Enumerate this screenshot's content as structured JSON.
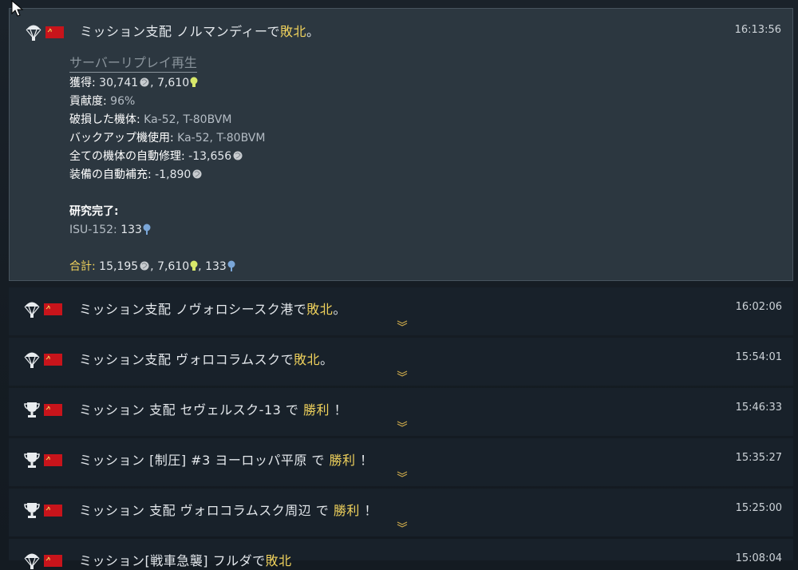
{
  "entries": [
    {
      "title_prefix": "ミッション支配 ノルマンディーで",
      "result": "敗北",
      "title_suffix": "。",
      "time": "16:13:56",
      "icon": "parachute-icon",
      "details": {
        "replay_label": "サーバーリプレイ再生",
        "earned_label": "獲得:",
        "earned_sl": "30,741",
        "earned_rp": "7,610",
        "activity_label": "貢献度:",
        "activity_value": "96%",
        "damaged_label": "破損した機体:",
        "damaged_value": "Ka-52, T-80BVM",
        "backup_label": "バックアップ機使用:",
        "backup_value": "Ka-52, T-80BVM",
        "repair_label": "全ての機体の自動修理:",
        "repair_value": "-13,656",
        "ammo_label": "装備の自動補充:",
        "ammo_value": "-1,890",
        "research_label": "研究完了:",
        "research_unit": "ISU-152:",
        "research_value": "133",
        "total_label": "合計:",
        "total_sl": "15,195",
        "total_rp": "7,610",
        "total_crp": "133"
      }
    },
    {
      "title_prefix": "ミッション支配 ノヴォロシースク港で",
      "result": "敗北",
      "title_suffix": "。",
      "time": "16:02:06",
      "icon": "parachute-icon"
    },
    {
      "title_prefix": "ミッション支配 ヴォロコラムスクで",
      "result": "敗北",
      "title_suffix": "。",
      "time": "15:54:01",
      "icon": "parachute-icon"
    },
    {
      "title_prefix": "ミッション 支配 セヴェルスク-13 で",
      "result": "勝利",
      "title_suffix": "！",
      "time": "15:46:33",
      "icon": "trophy-icon"
    },
    {
      "title_prefix": "ミッション [制圧] #3 ヨーロッパ平原 で",
      "result": "勝利",
      "title_suffix": "！",
      "time": "15:35:27",
      "icon": "trophy-icon"
    },
    {
      "title_prefix": "ミッション 支配 ヴォロコラムスク周辺 で",
      "result": "勝利",
      "title_suffix": "！",
      "time": "15:25:00",
      "icon": "trophy-icon"
    },
    {
      "title_prefix": "ミッション[戦車急襲] フルダで",
      "result": "敗北",
      "title_suffix": "",
      "time": "15:08:04",
      "icon": "parachute-icon"
    }
  ],
  "colors": {
    "highlight": "#f0d25c",
    "flag": "#c8141b",
    "rp": "#d8e86a",
    "crp": "#7aa6d8"
  }
}
